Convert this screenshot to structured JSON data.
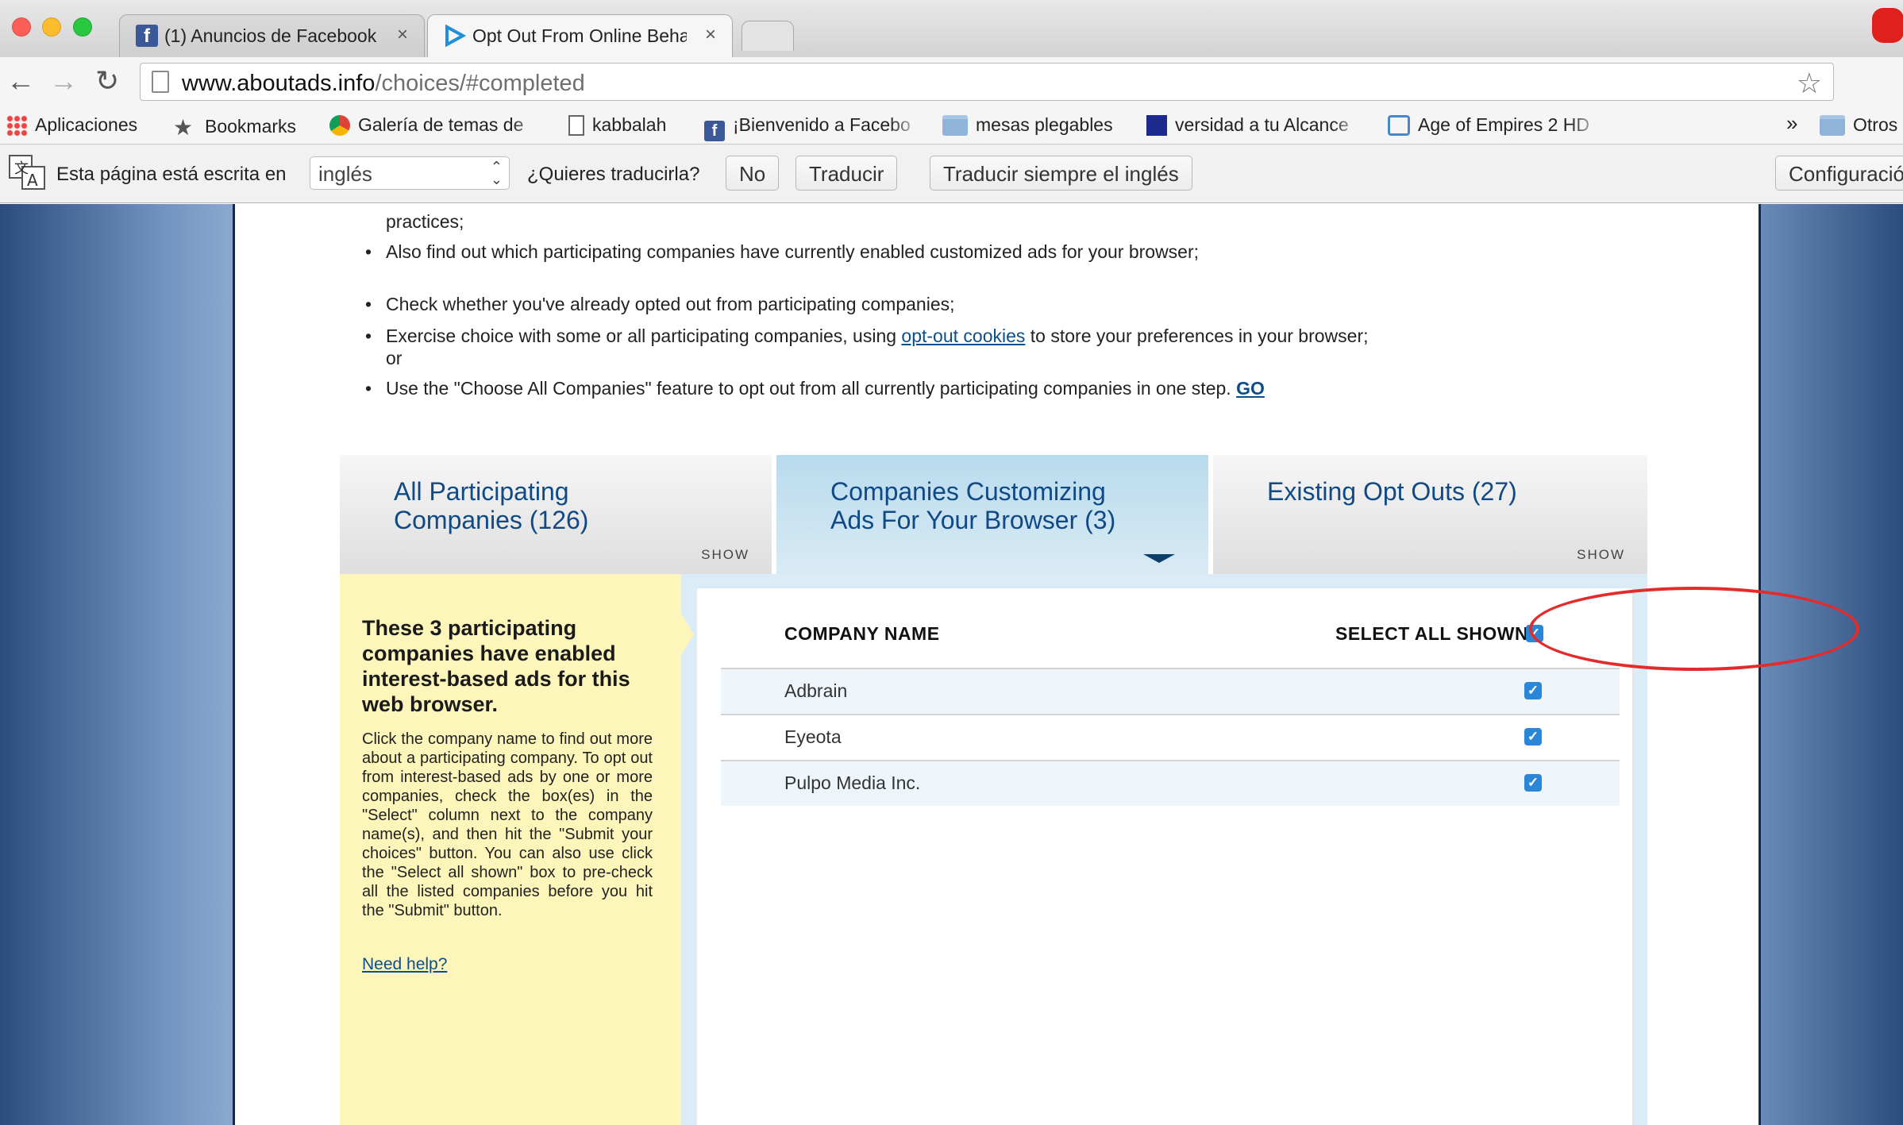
{
  "tabs": [
    {
      "title": "(1) Anuncios de Facebook",
      "close": "×"
    },
    {
      "title": "Opt Out From Online Behav",
      "close": "×"
    }
  ],
  "toolbar": {
    "url_host": "www.aboutads.info",
    "url_path": "/choices/#completed",
    "back": "←",
    "forward": "→",
    "reload": "↻",
    "star": "☆"
  },
  "bookmarks": {
    "items": [
      {
        "label": "Aplicaciones",
        "icon": "apps-grid-icon"
      },
      {
        "label": "Bookmarks",
        "icon": "star-icon"
      },
      {
        "label": "Galería de temas de",
        "icon": "chrome-icon"
      },
      {
        "label": "kabbalah",
        "icon": "document-icon"
      },
      {
        "label": "¡Bienvenido a Facebo",
        "icon": "facebook-icon"
      },
      {
        "label": "mesas plegables",
        "icon": "folder-icon"
      },
      {
        "label": "versidad a tu Alcance",
        "icon": "site-icon"
      },
      {
        "label": "Age of Empires 2 HD",
        "icon": "tv-icon"
      },
      {
        "label": "Otros",
        "icon": "folder-icon"
      }
    ],
    "overflow": "»"
  },
  "translate_bar": {
    "message": "Esta página está escrita en",
    "language": "inglés",
    "question": "¿Quieres traducirla?",
    "no": "No",
    "translate": "Traducir",
    "always": "Traducir siempre el inglés",
    "settings": "Configuración"
  },
  "bullets": {
    "b0_tail": "practices;",
    "b1": "Also find out which participating companies have currently enabled customized ads for your browser;",
    "b2": "Check whether you've already opted out from participating companies;",
    "b3_pre": "Exercise choice with some or all participating companies, using ",
    "b3_link": "opt-out cookies",
    "b3_post": " to store your preferences in your browser; or",
    "b4": "Use the \"Choose All Companies\" feature to opt out from all currently participating companies in one step. ",
    "b4_link": "GO"
  },
  "content_tabs": [
    {
      "label_l1": "All Participating",
      "label_l2": "Companies (126)",
      "action": "SHOW"
    },
    {
      "label_l1": "Companies Customizing",
      "label_l2": "Ads For Your Browser (3)"
    },
    {
      "label_l1": "Existing Opt Outs (27)",
      "label_l2": "",
      "action": "SHOW"
    }
  ],
  "info_panel": {
    "heading": "These 3 participating companies have enabled interest-based ads for this web browser.",
    "body": "Click the company name to find out more about a participating company. To opt out from interest-based ads by one or more companies, check the box(es) in the \"Select\" column next to the company name(s), and then hit the \"Submit your choices\" button. You can also use click the \"Select all shown\" box to pre-check all the listed companies before you hit the \"Submit\" button.",
    "help": "Need help?"
  },
  "table": {
    "col_company": "COMPANY NAME",
    "col_select": "SELECT ALL SHOWN",
    "rows": [
      {
        "name": "Adbrain",
        "checked": true
      },
      {
        "name": "Eyeota",
        "checked": true
      },
      {
        "name": "Pulpo Media Inc.",
        "checked": true
      }
    ],
    "check_glyph": "✓"
  }
}
